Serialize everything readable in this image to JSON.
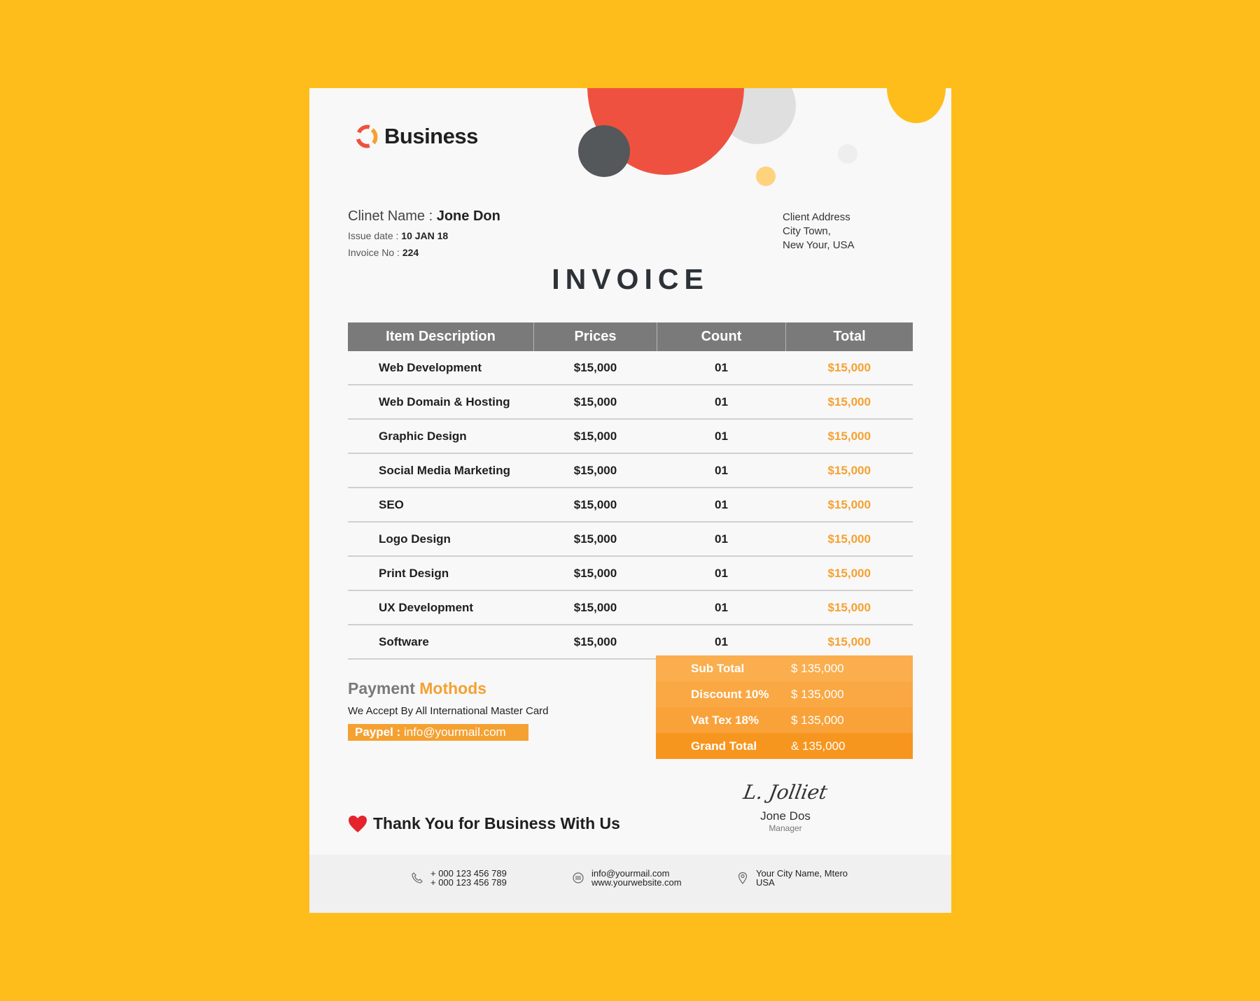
{
  "brand": {
    "name": "Business"
  },
  "client": {
    "name_label": "Clinet Name :",
    "name_value": "Jone Don",
    "issue_label": "Issue date :",
    "issue_value": "10 JAN 18",
    "invoice_label": "Invoice No :",
    "invoice_value": "224",
    "address": [
      "Client Address",
      "City Town,",
      "New Your, USA"
    ]
  },
  "title": "INVOICE",
  "table": {
    "headers": [
      "Item Description",
      "Prices",
      "Count",
      "Total"
    ],
    "rows": [
      {
        "desc": "Web Development",
        "price": "$15,000",
        "count": "01",
        "total": "$15,000"
      },
      {
        "desc": "Web Domain & Hosting",
        "price": "$15,000",
        "count": "01",
        "total": "$15,000"
      },
      {
        "desc": "Graphic Design",
        "price": "$15,000",
        "count": "01",
        "total": "$15,000"
      },
      {
        "desc": "Social Media Marketing",
        "price": "$15,000",
        "count": "01",
        "total": "$15,000"
      },
      {
        "desc": "SEO",
        "price": "$15,000",
        "count": "01",
        "total": "$15,000"
      },
      {
        "desc": "Logo Design",
        "price": "$15,000",
        "count": "01",
        "total": "$15,000"
      },
      {
        "desc": "Print Design",
        "price": "$15,000",
        "count": "01",
        "total": "$15,000"
      },
      {
        "desc": "UX Development",
        "price": "$15,000",
        "count": "01",
        "total": "$15,000"
      },
      {
        "desc": "Software",
        "price": "$15,000",
        "count": "01",
        "total": "$15,000"
      }
    ]
  },
  "payment": {
    "title_a": "Payment",
    "title_b": "Mothods",
    "subtitle": "We Accept By All International Master Card",
    "paypal_label": "Paypel :",
    "paypal_value": "info@yourmail.com"
  },
  "totals": [
    {
      "label": "Sub Total",
      "value": "$ 135,000"
    },
    {
      "label": "Discount 10%",
      "value": "$ 135,000"
    },
    {
      "label": "Vat Tex 18%",
      "value": "$ 135,000"
    },
    {
      "label": "Grand Total",
      "value": "& 135,000"
    }
  ],
  "thanks": "Thank You for Business With Us",
  "signature": {
    "script": "L. Jolliet",
    "name": "Jone Dos",
    "role": "Manager"
  },
  "footer": {
    "phone": [
      "+ 000 123 456 789",
      "+ 000 123 456 789"
    ],
    "web": [
      "info@yourmail.com",
      "www.yourwebsite.com"
    ],
    "location": [
      "Your City Name, Mtero",
      "USA"
    ]
  },
  "colors": {
    "background": "#FFBD1B",
    "accent": "#F5A131",
    "header": "#7A7A7A",
    "red": "#EF5140"
  }
}
